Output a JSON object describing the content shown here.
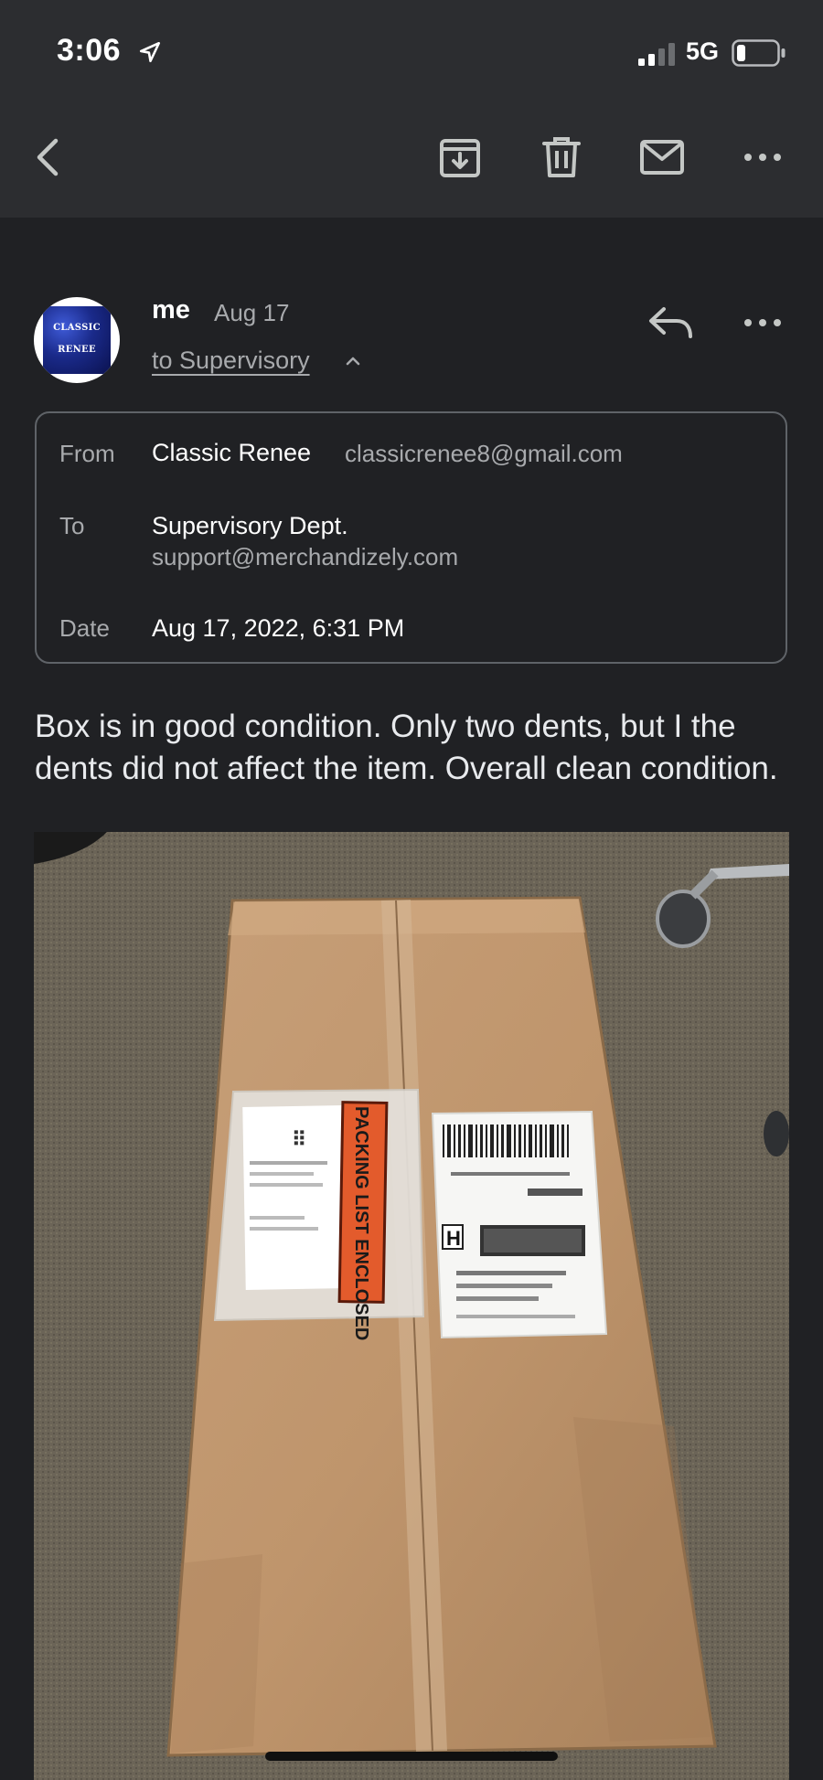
{
  "status_bar": {
    "time": "3:06",
    "network": "5G",
    "icons": [
      "location-arrow-icon",
      "signal-bars-icon",
      "battery-icon"
    ]
  },
  "toolbar": {
    "icons": [
      "back-chevron-icon",
      "archive-icon",
      "trash-icon",
      "mail-icon",
      "more-horizontal-icon"
    ]
  },
  "message": {
    "avatar_text_line1": "CLASSIC",
    "avatar_text_line2": "RENEE",
    "sender": "me",
    "date": "Aug 17",
    "recipient_summary": "to Supervisory",
    "details": {
      "from_label": "From",
      "from_name": "Classic Renee",
      "from_email": "classicrenee8@gmail.com",
      "to_label": "To",
      "to_name": "Supervisory Dept.",
      "to_email": "support@merchandizely.com",
      "date_label": "Date",
      "date_value": "Aug 17, 2022, 6:31 PM"
    },
    "body": "Box is in good condition. Only two dents, but I the dents did not affect the item. Overall clean condition."
  },
  "attachment": {
    "packing_slip_sticker": "PACKING LIST ENCLOSED",
    "slip_logo": "wa",
    "label_letter": "H"
  },
  "colors": {
    "background": "#202124",
    "toolbar": "#2c2d30",
    "secondary_text": "#a8aaad",
    "border": "#5f6368"
  }
}
